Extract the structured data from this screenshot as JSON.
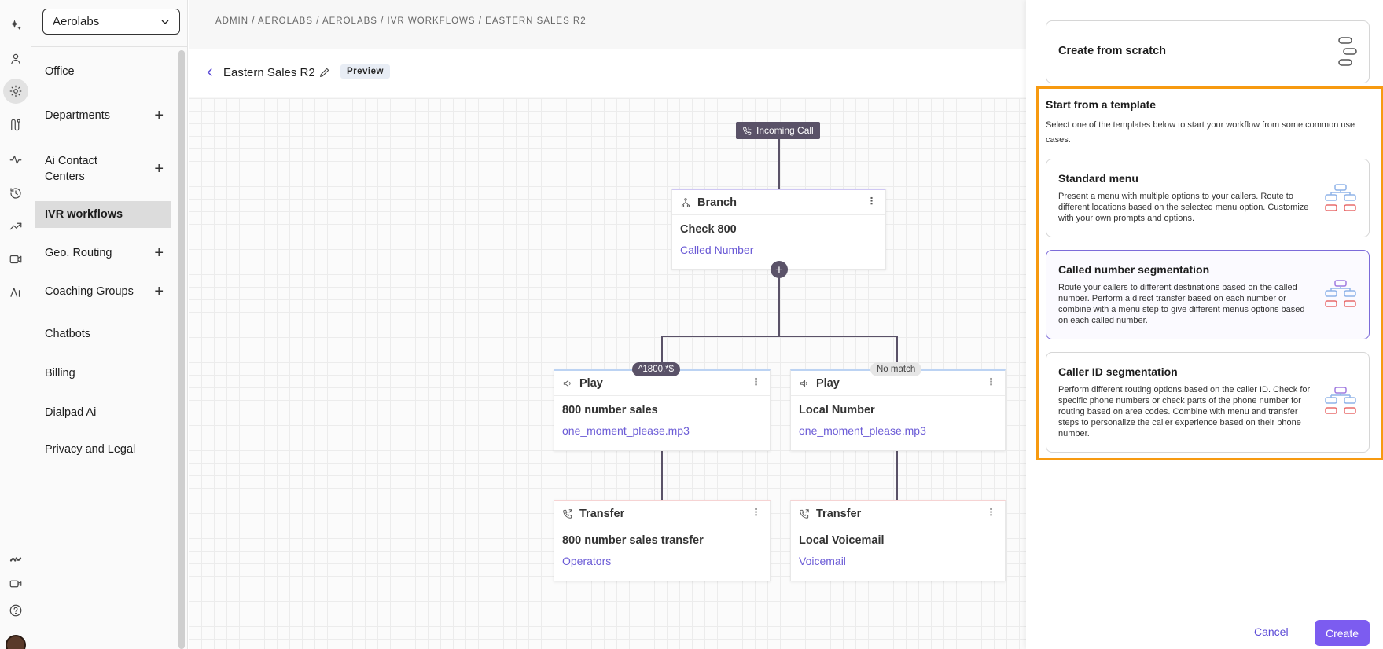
{
  "rail": {
    "icons": [
      "sparkle-icon",
      "person-icon",
      "settings-icon",
      "routes-icon",
      "activity-icon",
      "history-icon",
      "trending-icon",
      "video-agent-icon",
      "ai-icon",
      "brand-icon",
      "camera-icon",
      "help-icon"
    ]
  },
  "nav": {
    "org": "Aerolabs",
    "items": [
      {
        "label": "Office",
        "plus": false
      },
      {
        "label": "Departments",
        "plus": true
      },
      {
        "label": "Ai Contact Centers",
        "plus": true
      },
      {
        "label": "IVR workflows",
        "plus": false,
        "active": true
      },
      {
        "label": "Geo. Routing",
        "plus": true
      },
      {
        "label": "Coaching Groups",
        "plus": true
      },
      {
        "label": "Chatbots",
        "plus": false
      },
      {
        "label": "Billing",
        "plus": false
      },
      {
        "label": "Dialpad Ai",
        "plus": false
      },
      {
        "label": "Privacy and Legal",
        "plus": false
      }
    ]
  },
  "main": {
    "breadcrumb": "ADMIN / AEROLABS / AEROLABS / IVR WORKFLOWS / EASTERN SALES R2",
    "title": "Eastern Sales R2",
    "preview_label": "Preview"
  },
  "flow": {
    "incoming": "Incoming Call",
    "branch": {
      "header": "Branch",
      "title": "Check 800",
      "link": "Called Number"
    },
    "add_symbol": "+",
    "pill_left": "^1800.*$",
    "pill_right": "No match",
    "play_left": {
      "header": "Play",
      "title": "800 number sales",
      "link": "one_moment_please.mp3"
    },
    "play_right": {
      "header": "Play",
      "title": "Local Number",
      "link": "one_moment_please.mp3"
    },
    "transfer_left": {
      "header": "Transfer",
      "title": "800 number sales transfer",
      "link": "Operators"
    },
    "transfer_right": {
      "header": "Transfer",
      "title": "Local Voicemail",
      "link": "Voicemail"
    }
  },
  "panel": {
    "scratch": "Create from scratch",
    "template_heading": "Start from a template",
    "template_sub": "Select one of the templates below to start your workflow from some common use cases.",
    "templates": [
      {
        "title": "Standard menu",
        "desc": "Present a menu with multiple options to your callers. Route to different locations based on the selected menu option. Customize with your own prompts and options."
      },
      {
        "title": "Called number segmentation",
        "desc": "Route your callers to different destinations based on the called number. Perform a direct transfer based on each number or combine with a menu step to give different menus options based on each called number."
      },
      {
        "title": "Caller ID segmentation",
        "desc": "Perform different routing options based on the caller ID. Check for specific phone numbers or check parts of the phone number for routing based on area codes. Combine with menu and transfer steps to personalize the caller experience based on their phone number."
      }
    ],
    "cancel": "Cancel",
    "create": "Create"
  },
  "colors": {
    "accent": "#7c5cf0",
    "highlight": "#f79a10",
    "link": "#6b5bd6",
    "node_dark": "#5a5268"
  }
}
